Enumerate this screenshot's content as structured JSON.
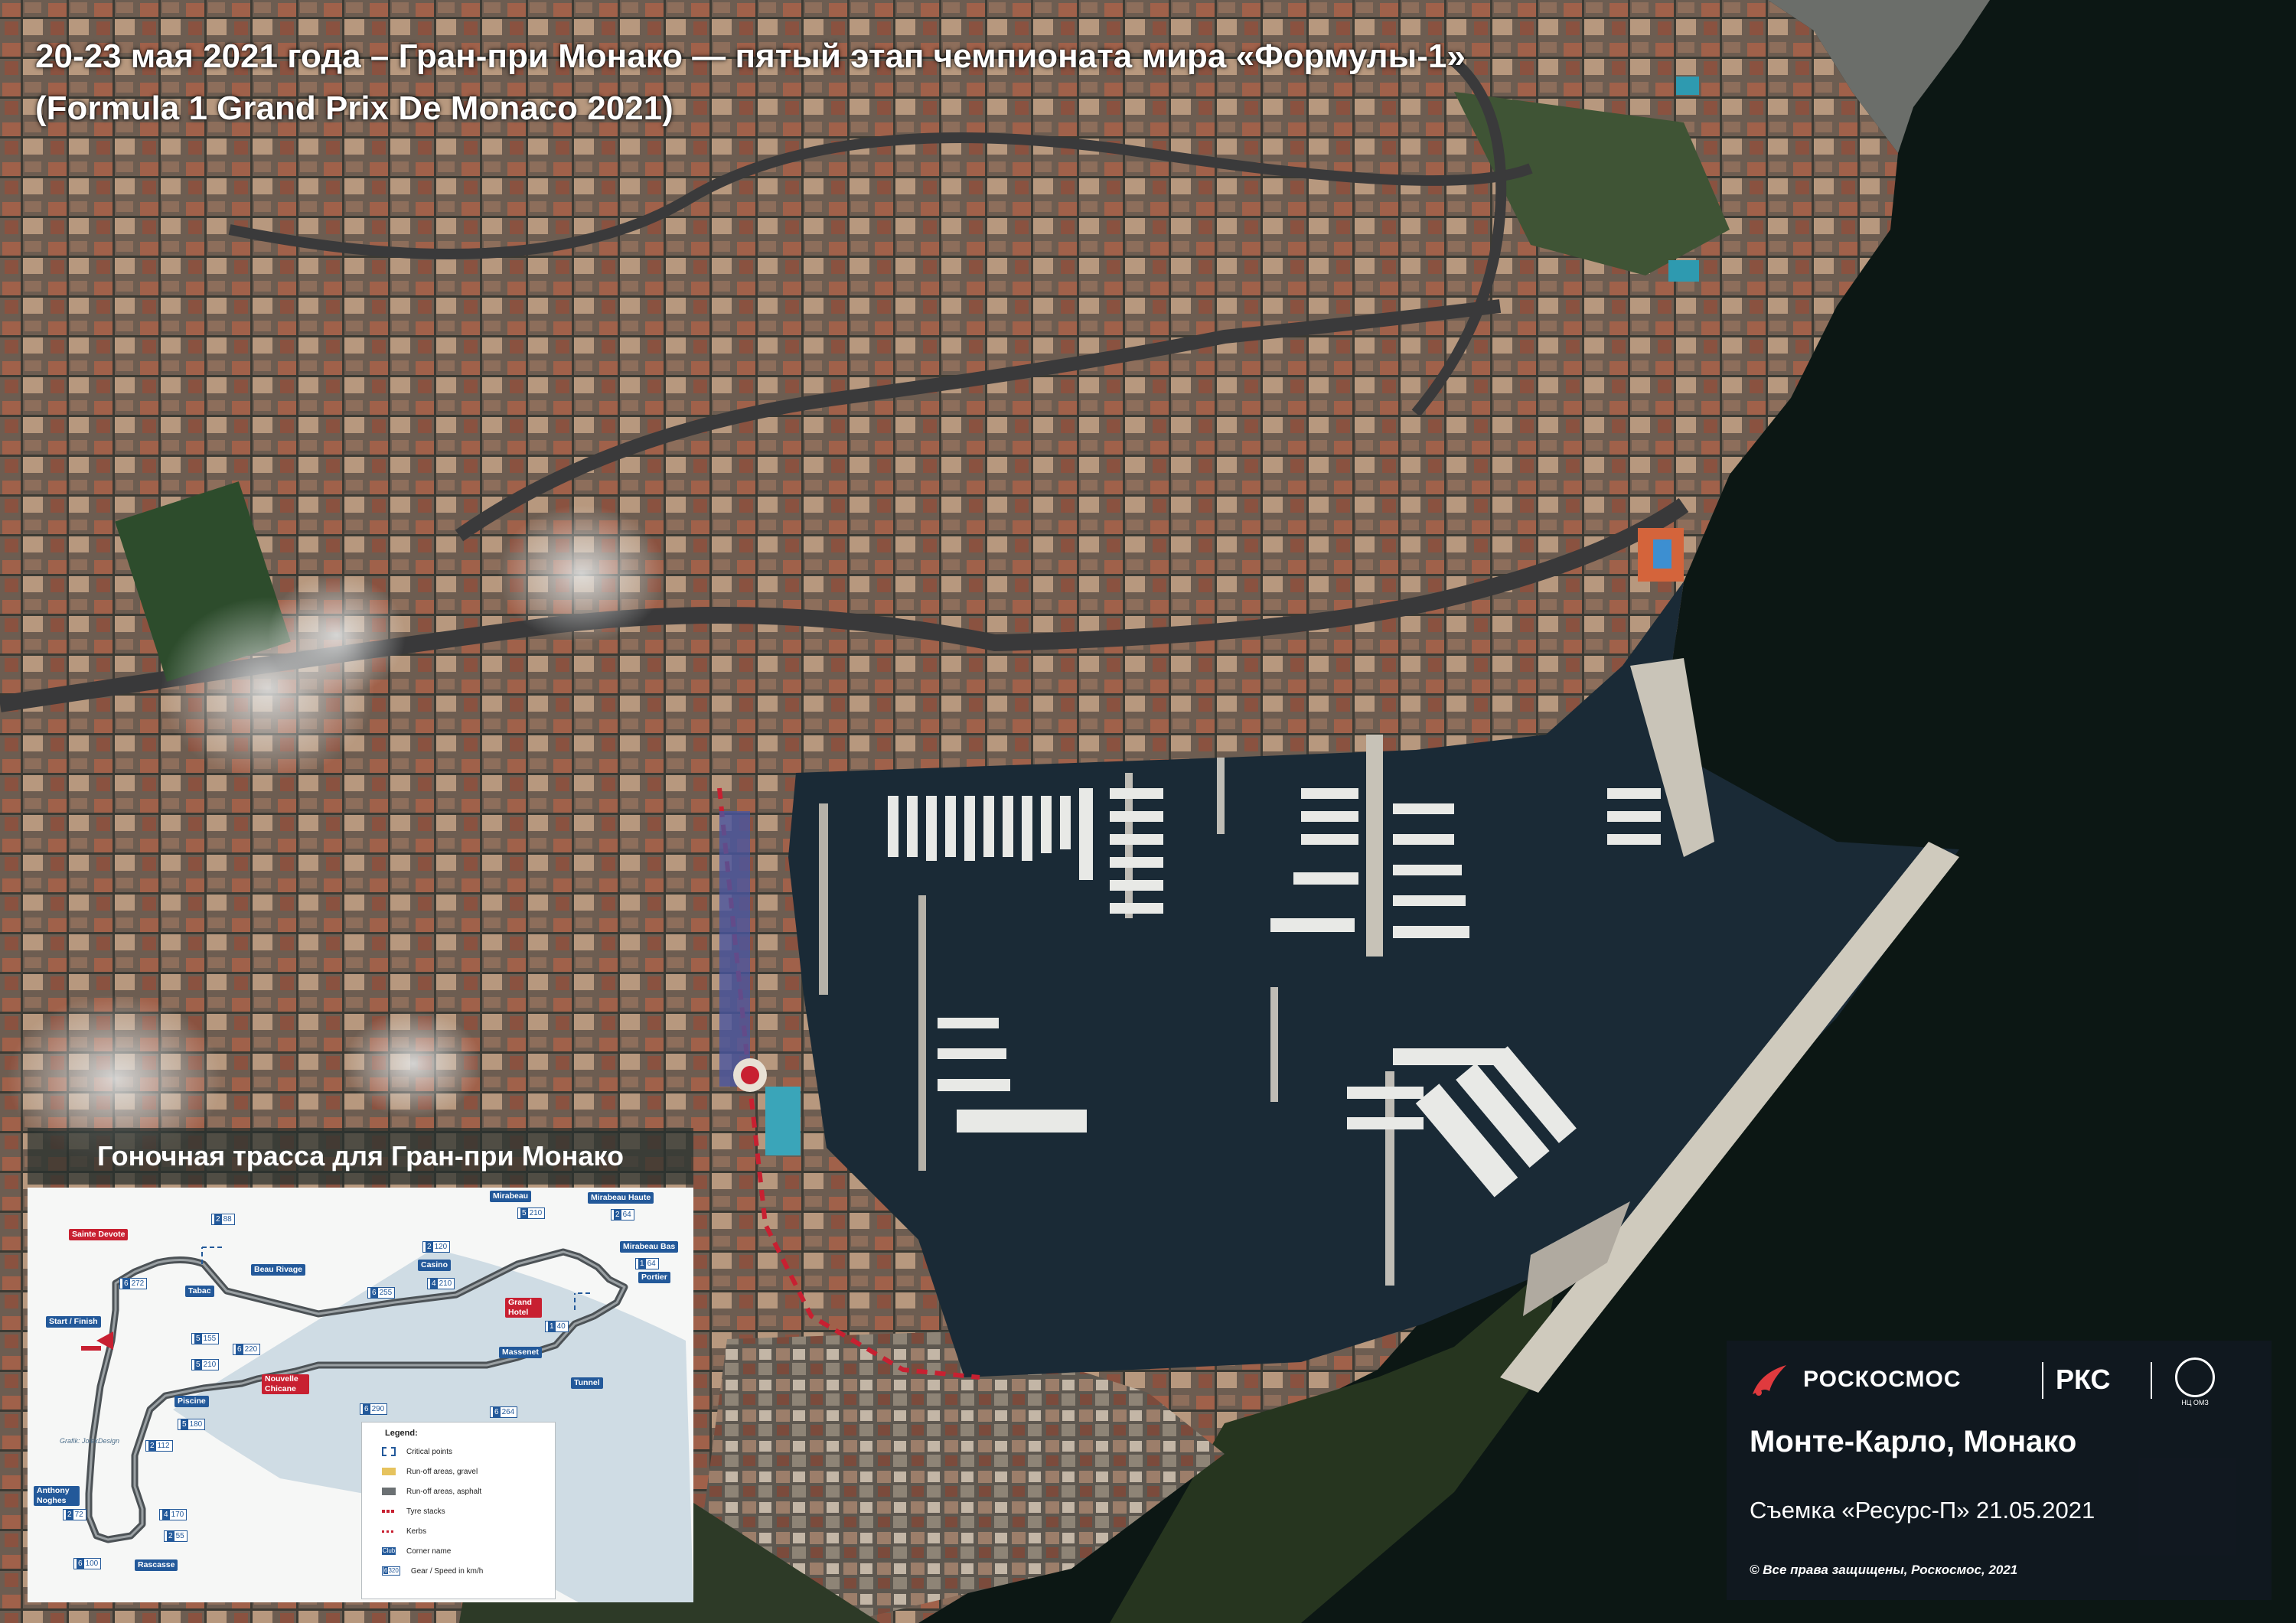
{
  "title": {
    "line1": "20-23 мая 2021 года – Гран-при Монако — пятый этап чемпионата мира «Формулы-1»",
    "line2": "(Formula 1 Grand Prix De Monaco 2021)"
  },
  "inset": {
    "title": "Гоночная трасса для Гран-при Монако",
    "corners": {
      "sainte_devote": "Sainte Devote",
      "beau_rivage": "Beau Rivage",
      "mirabeau": "Mirabeau",
      "mirabeau_haute": "Mirabeau Haute",
      "mirabeau_bas": "Mirabeau Bas",
      "portier": "Portier",
      "casino": "Casino",
      "grand_hotel": "Grand Hotel",
      "massenet": "Massenet",
      "tabac": "Tabac",
      "tunnel": "Tunnel",
      "nouvelle_chicane": "Nouvelle Chicane",
      "start_finish": "Start / Finish",
      "piscine": "Piscine",
      "anthony_noghes": "Anthony Noghes",
      "rascasse": "Rascasse"
    },
    "speeds": {
      "s1": {
        "gear": "2",
        "speed": "88"
      },
      "s2": {
        "gear": "6",
        "speed": "272"
      },
      "s3": {
        "gear": "5",
        "speed": "210"
      },
      "s4": {
        "gear": "2",
        "speed": "64"
      },
      "s5": {
        "gear": "2",
        "speed": "120"
      },
      "s6": {
        "gear": "4",
        "speed": "210"
      },
      "s7": {
        "gear": "6",
        "speed": "255"
      },
      "s8": {
        "gear": "1",
        "speed": "64"
      },
      "s9": {
        "gear": "1",
        "speed": "40"
      },
      "s10": {
        "gear": "5",
        "speed": "155"
      },
      "s11": {
        "gear": "6",
        "speed": "220"
      },
      "s12": {
        "gear": "5",
        "speed": "210"
      },
      "s13": {
        "gear": "6",
        "speed": "290"
      },
      "s14": {
        "gear": "6",
        "speed": "264"
      },
      "s15": {
        "gear": "5",
        "speed": "180"
      },
      "s16": {
        "gear": "2",
        "speed": "112"
      },
      "s17": {
        "gear": "2",
        "speed": "72"
      },
      "s18": {
        "gear": "4",
        "speed": "170"
      },
      "s19": {
        "gear": "2",
        "speed": "55"
      },
      "s20": {
        "gear": "6",
        "speed": "100"
      }
    },
    "credit": "Grafik: JolekDesign",
    "legend": {
      "title": "Legend:",
      "items": [
        "Critical points",
        "Run-off areas, gravel",
        "Run-off areas, asphalt",
        "Tyre stacks",
        "Kerbs",
        "Corner name",
        "Gear / Speed in km/h"
      ],
      "sample_club": "Club",
      "sample_gear": "6",
      "sample_speed": "320"
    }
  },
  "brand": {
    "roscosmos": "РОСКОСМОС",
    "rks": "РКС",
    "emblem": "НЦ ОМЗ",
    "location": "Монте-Карло, Монако",
    "capture": "Съемка «Ресурс-П» 21.05.2021",
    "copyright": "© Все права защищены, Роскосмос, 2021"
  },
  "colors": {
    "sea": "#0c1714",
    "harbor": "#1a2a36",
    "track": "#3f4648",
    "kerb_red": "#c82031",
    "label_blue": "#23599a",
    "brand_panel": "#121822"
  }
}
